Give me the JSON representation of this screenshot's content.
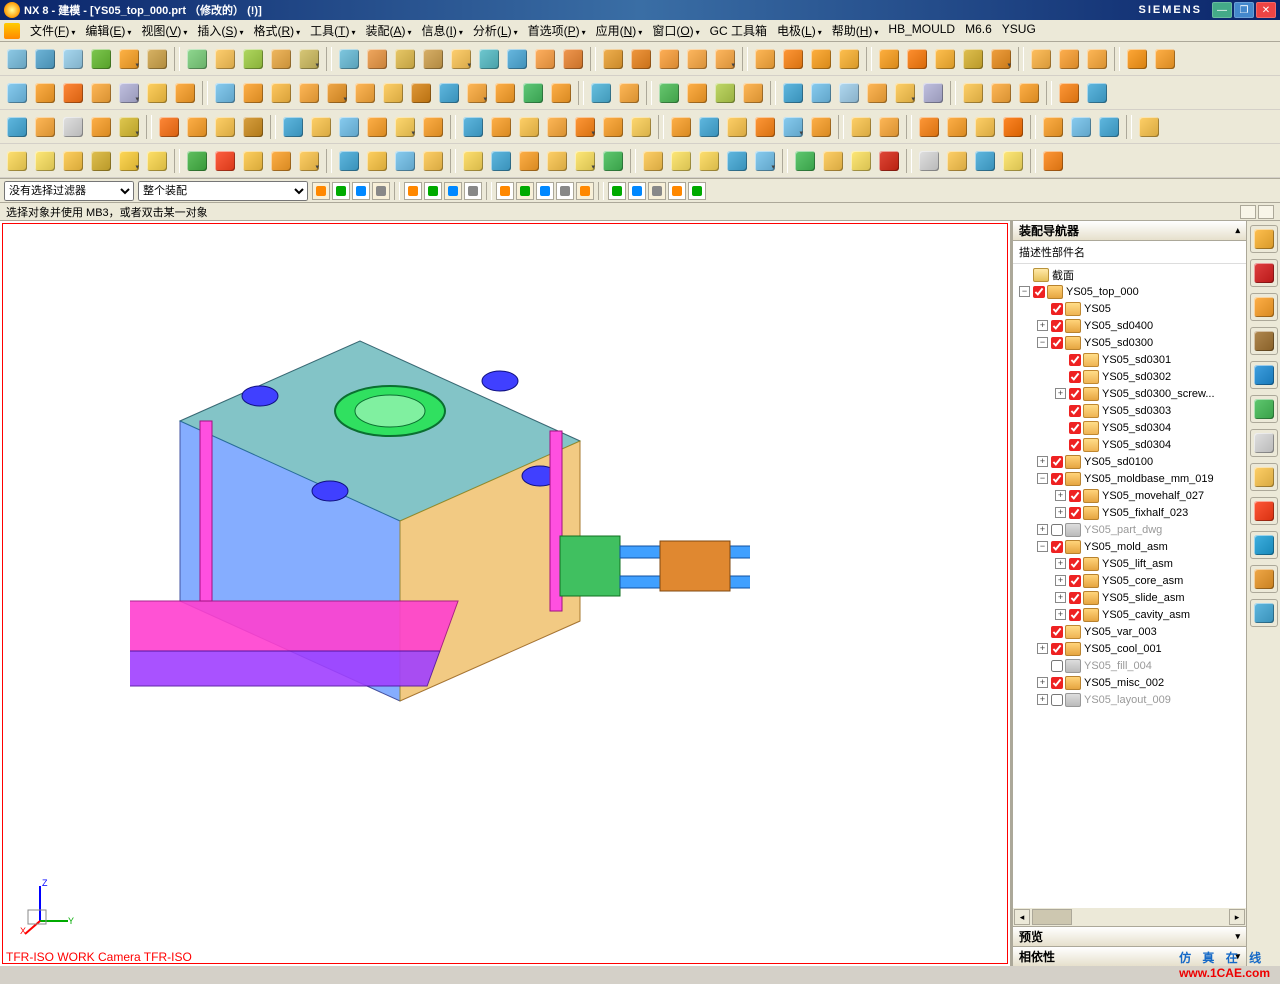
{
  "title": "NX 8 - 建模 - [YS05_top_000.prt （修改的）    (!)]",
  "brand": "SIEMENS",
  "menu": [
    {
      "l": "文件(F)",
      "d": 1
    },
    {
      "l": "编辑(E)",
      "d": 1
    },
    {
      "l": "视图(V)",
      "d": 1
    },
    {
      "l": "插入(S)",
      "d": 1
    },
    {
      "l": "格式(R)",
      "d": 1
    },
    {
      "l": "工具(T)",
      "d": 1
    },
    {
      "l": "装配(A)",
      "d": 1
    },
    {
      "l": "信息(I)",
      "d": 1
    },
    {
      "l": "分析(L)",
      "d": 1
    },
    {
      "l": "首选项(P)",
      "d": 1
    },
    {
      "l": "应用(N)",
      "d": 1
    },
    {
      "l": "窗口(O)",
      "d": 1
    },
    {
      "l": "GC 工具箱",
      "d": 0
    },
    {
      "l": "电极(L)",
      "d": 1
    },
    {
      "l": "帮助(H)",
      "d": 1
    },
    {
      "l": "HB_MOULD",
      "d": 0
    },
    {
      "l": "M6.6",
      "d": 0
    },
    {
      "l": "YSUG",
      "d": 0
    }
  ],
  "filterLabel": "没有选择过滤器",
  "scopeLabel": "整个装配",
  "statusMsg": "选择对象并使用 MB3，或者双击某一对象",
  "viewportHint": "TFR-ISO WORK Camera TFR-ISO",
  "nav": {
    "title": "装配导航器",
    "column": "描述性部件名",
    "preview": "预览",
    "deps": "相依性"
  },
  "tree": [
    {
      "ind": 0,
      "tw": "",
      "chk": null,
      "pic": "folder",
      "t": "截面",
      "dim": 0
    },
    {
      "ind": 0,
      "tw": "-",
      "chk": 1,
      "pic": "asm",
      "t": "YS05_top_000",
      "dim": 0
    },
    {
      "ind": 1,
      "tw": "",
      "chk": 1,
      "pic": "part",
      "t": "YS05",
      "dim": 0
    },
    {
      "ind": 1,
      "tw": "+",
      "chk": 1,
      "pic": "asm",
      "t": "YS05_sd0400",
      "dim": 0
    },
    {
      "ind": 1,
      "tw": "-",
      "chk": 1,
      "pic": "asm",
      "t": "YS05_sd0300",
      "dim": 0
    },
    {
      "ind": 2,
      "tw": "",
      "chk": 1,
      "pic": "part",
      "t": "YS05_sd0301",
      "dim": 0
    },
    {
      "ind": 2,
      "tw": "",
      "chk": 1,
      "pic": "part",
      "t": "YS05_sd0302",
      "dim": 0
    },
    {
      "ind": 2,
      "tw": "+",
      "chk": 1,
      "pic": "asm",
      "t": "YS05_sd0300_screw...",
      "dim": 0
    },
    {
      "ind": 2,
      "tw": "",
      "chk": 1,
      "pic": "part",
      "t": "YS05_sd0303",
      "dim": 0
    },
    {
      "ind": 2,
      "tw": "",
      "chk": 1,
      "pic": "part",
      "t": "YS05_sd0304",
      "dim": 0
    },
    {
      "ind": 2,
      "tw": "",
      "chk": 1,
      "pic": "part",
      "t": "YS05_sd0304",
      "dim": 0
    },
    {
      "ind": 1,
      "tw": "+",
      "chk": 1,
      "pic": "asm",
      "t": "YS05_sd0100",
      "dim": 0
    },
    {
      "ind": 1,
      "tw": "-",
      "chk": 1,
      "pic": "asm",
      "t": "YS05_moldbase_mm_019",
      "dim": 0
    },
    {
      "ind": 2,
      "tw": "+",
      "chk": 1,
      "pic": "asm",
      "t": "YS05_movehalf_027",
      "dim": 0
    },
    {
      "ind": 2,
      "tw": "+",
      "chk": 1,
      "pic": "asm",
      "t": "YS05_fixhalf_023",
      "dim": 0
    },
    {
      "ind": 1,
      "tw": "+",
      "chk": 0,
      "pic": "gray",
      "t": "YS05_part_dwg",
      "dim": 1
    },
    {
      "ind": 1,
      "tw": "-",
      "chk": 1,
      "pic": "asm",
      "t": "YS05_mold_asm",
      "dim": 0
    },
    {
      "ind": 2,
      "tw": "+",
      "chk": 1,
      "pic": "asm",
      "t": "YS05_lift_asm",
      "dim": 0
    },
    {
      "ind": 2,
      "tw": "+",
      "chk": 1,
      "pic": "asm",
      "t": "YS05_core_asm",
      "dim": 0
    },
    {
      "ind": 2,
      "tw": "+",
      "chk": 1,
      "pic": "asm",
      "t": "YS05_slide_asm",
      "dim": 0
    },
    {
      "ind": 2,
      "tw": "+",
      "chk": 1,
      "pic": "asm",
      "t": "YS05_cavity_asm",
      "dim": 0
    },
    {
      "ind": 1,
      "tw": "",
      "chk": 1,
      "pic": "part",
      "t": "YS05_var_003",
      "dim": 0
    },
    {
      "ind": 1,
      "tw": "+",
      "chk": 1,
      "pic": "asm",
      "t": "YS05_cool_001",
      "dim": 0
    },
    {
      "ind": 1,
      "tw": "",
      "chk": 0,
      "pic": "gray",
      "t": "YS05_fill_004",
      "dim": 1
    },
    {
      "ind": 1,
      "tw": "+",
      "chk": 1,
      "pic": "asm",
      "t": "YS05_misc_002",
      "dim": 0
    },
    {
      "ind": 1,
      "tw": "+",
      "chk": 0,
      "pic": "gray",
      "t": "YS05_layout_009",
      "dim": 1
    }
  ],
  "toolrows": [
    [
      [
        "#8ecae6",
        "#6fb5d8",
        "#a8d8f0",
        "#7ec850",
        "#ffb347",
        "#d8b365"
      ],
      "|",
      [
        "#90d890",
        "#ffcf70",
        "#b0d860",
        "#f0b860",
        "#d8c878"
      ],
      "|",
      [
        "#80c8e0",
        "#f0a860",
        "#e8c868",
        "#d8b068",
        "#ffd070",
        "#70c8d0",
        "#68b8e0",
        "#ffb060",
        "#f09850"
      ],
      "|",
      [
        "#f0b050",
        "#f09840",
        "#ffb058",
        "#ffb860",
        "#ffb860"
      ],
      "|",
      [
        "#ffb858",
        "#ff9838",
        "#ffb040",
        "#ffc050"
      ],
      "|",
      [
        "#ffb040",
        "#ff9030",
        "#ffc050",
        "#e0c050",
        "#f0a040"
      ],
      "|",
      [
        "#ffc060",
        "#ffb050",
        "#ffb858"
      ],
      "|",
      [
        "#ffa838",
        "#ffb048"
      ]
    ],
    [
      [
        "#88ccf0",
        "#ffb048",
        "#ff8838",
        "#ffb858",
        "#c0c0e0",
        "#ffd060",
        "#ffb048"
      ],
      "|",
      [
        "#88ccf0",
        "#ffb048",
        "#ffc860",
        "#ffb858",
        "#f0a848",
        "#ffb858",
        "#ffd068",
        "#e09838",
        "#60b8e0",
        "#ffb858",
        "#ffb048",
        "#60c878",
        "#ffb048"
      ],
      "|",
      [
        "#68c0e0",
        "#ffb858"
      ],
      "|",
      [
        "#68c870",
        "#ffb048",
        "#c0d868",
        "#ffb858"
      ],
      "|",
      [
        "#60b8e0",
        "#88ccf0",
        "#b0d8f0",
        "#ffb858",
        "#ffd068",
        "#c0c0e0"
      ],
      "|",
      [
        "#ffd068",
        "#ffb858",
        "#ffb048"
      ],
      "|",
      [
        "#ff9838",
        "#60b8e0"
      ]
    ],
    [
      [
        "#60b8e0",
        "#ffb858",
        "#e0e0e0",
        "#ffb048",
        "#e0c850"
      ],
      "|",
      [
        "#ff8838",
        "#ffb048",
        "#ffd068",
        "#d8a040"
      ],
      "|",
      [
        "#60b8e0",
        "#ffd068",
        "#88ccf0",
        "#ffb048",
        "#ffd870",
        "#ffb048"
      ],
      "|",
      [
        "#60b8e0",
        "#ffb048",
        "#ffd068",
        "#ffb858",
        "#ff9838",
        "#ffb048",
        "#ffd870"
      ],
      "|",
      [
        "#ffb048",
        "#60b8e0",
        "#ffd068",
        "#ff9838",
        "#88ccf0",
        "#ffb048"
      ],
      "|",
      [
        "#ffd068",
        "#ffb858"
      ],
      "|",
      [
        "#ff9838",
        "#ffb048",
        "#ffd068",
        "#ff8828"
      ],
      "|",
      [
        "#ffb048",
        "#88ccf0",
        "#60b8e0"
      ],
      "|",
      [
        "#ffd068"
      ]
    ],
    [
      [
        "#ffe070",
        "#ffe878",
        "#ffd060",
        "#e0c050",
        "#ffd858",
        "#ffe068"
      ],
      "|",
      [
        "#60c060",
        "#ff6040",
        "#ffd060",
        "#ffb048",
        "#ffd068"
      ],
      "|",
      [
        "#60b8e0",
        "#ffd060",
        "#88ccf0",
        "#ffd068"
      ],
      "|",
      [
        "#ffe070",
        "#60b8e0",
        "#ffb048",
        "#ffd068",
        "#ffe878",
        "#60c870"
      ],
      "|",
      [
        "#ffd068",
        "#ffe878",
        "#ffe070",
        "#60b8e0",
        "#88ccf0"
      ],
      "|",
      [
        "#60c870",
        "#ffd068",
        "#ffe878",
        "#e04838"
      ],
      "|",
      [
        "#e0e0e0",
        "#ffd068",
        "#60b8e0",
        "#ffe878"
      ],
      "|",
      [
        "#ff9838"
      ]
    ]
  ],
  "selectorBtns": 18,
  "rightbar": [
    "#ffc050",
    "#e04040",
    "#ffb048",
    "#b08850",
    "#40a0e0",
    "#60c870",
    "#e0e0e0",
    "#ffd068",
    "#ff5838",
    "#40b0e0",
    "#f0a848",
    "#60b8e0"
  ],
  "footer": {
    "cn": "仿 真 在 线",
    "url": "www.1CAE.com"
  }
}
